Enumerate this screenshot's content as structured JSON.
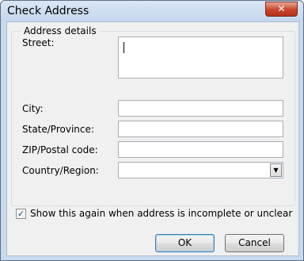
{
  "window": {
    "title": "Check Address",
    "close_glyph": "✕"
  },
  "group": {
    "label": "Address details"
  },
  "fields": {
    "street": {
      "label": "Street:",
      "value": ""
    },
    "city": {
      "label": "City:",
      "value": ""
    },
    "state": {
      "label": "State/Province:",
      "value": ""
    },
    "zip": {
      "label": "ZIP/Postal code:",
      "value": ""
    },
    "country": {
      "label": "Country/Region:",
      "value": "",
      "dropdown_glyph": "▼"
    }
  },
  "show_again": {
    "label": "Show this again when address is incomplete or unclear",
    "checked": true,
    "check_glyph": "✓"
  },
  "buttons": {
    "ok": "OK",
    "cancel": "Cancel"
  },
  "colors": {
    "title_bar": "#c3d6ec",
    "close_button": "#c8442a",
    "client_bg": "#f0f0f0"
  }
}
